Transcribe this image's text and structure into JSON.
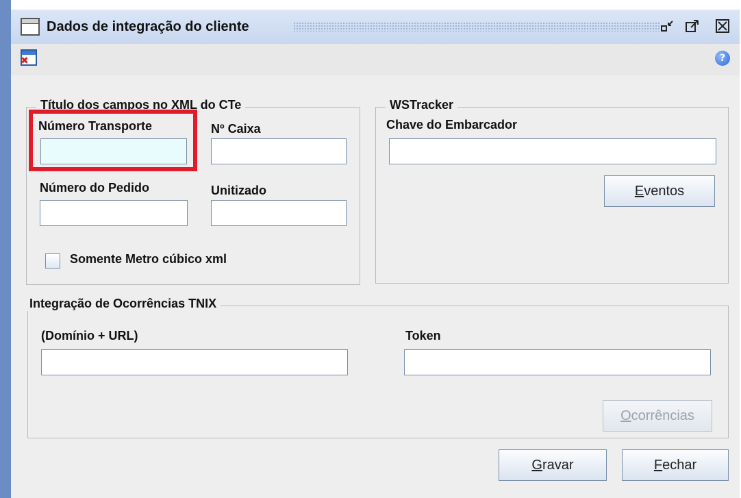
{
  "window": {
    "title": "Dados de integração do cliente",
    "controls": [
      "minimize-icon",
      "maximize-icon",
      "close-icon"
    ]
  },
  "toolbar": {
    "close_icon": "window-close-icon",
    "help_icon": "help-icon"
  },
  "cte_section": {
    "legend": "Título dos campos  no XML do CTe",
    "numero_transporte_label": "Número Transporte",
    "numero_transporte_value": "",
    "caixa_label": "Nº Caixa",
    "caixa_value": "",
    "numero_pedido_label": "Número do Pedido",
    "numero_pedido_value": "",
    "unitizado_label": "Unitizado",
    "unitizado_value": "",
    "metro_cubico_label": "Somente Metro cúbico xml",
    "metro_cubico_checked": false
  },
  "wstracker": {
    "legend": "WSTracker",
    "chave_label": "Chave do Embarcador",
    "chave_value": "",
    "eventos_button": {
      "mnemonic": "E",
      "rest": "ventos"
    }
  },
  "tnix": {
    "legend": "Integração de Ocorrências TNIX",
    "dominio_label": "(Domínio + URL)",
    "dominio_value": "",
    "token_label": "Token",
    "token_value": "",
    "ocorrencias_button": {
      "mnemonic": "O",
      "rest": "corrências",
      "enabled": false
    }
  },
  "footer": {
    "gravar_button": {
      "mnemonic": "G",
      "rest": "ravar"
    },
    "fechar_button": {
      "mnemonic": "F",
      "rest": "echar"
    }
  },
  "colors": {
    "highlight": "#e11b2a",
    "focused_field_bg": "#e9fcfd",
    "window_border": "#6a8ec7"
  }
}
